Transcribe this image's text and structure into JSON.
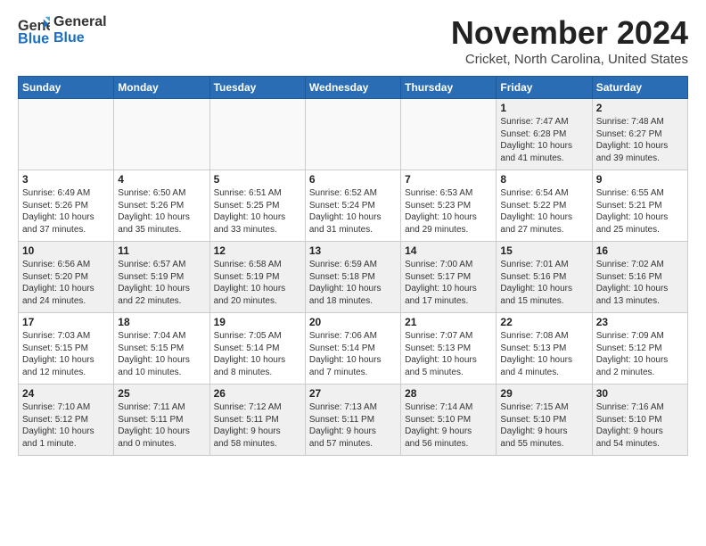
{
  "header": {
    "logo_line1": "General",
    "logo_line2": "Blue",
    "month_title": "November 2024",
    "location": "Cricket, North Carolina, United States"
  },
  "weekdays": [
    "Sunday",
    "Monday",
    "Tuesday",
    "Wednesday",
    "Thursday",
    "Friday",
    "Saturday"
  ],
  "weeks": [
    [
      {
        "day": "",
        "info": ""
      },
      {
        "day": "",
        "info": ""
      },
      {
        "day": "",
        "info": ""
      },
      {
        "day": "",
        "info": ""
      },
      {
        "day": "",
        "info": ""
      },
      {
        "day": "1",
        "info": "Sunrise: 7:47 AM\nSunset: 6:28 PM\nDaylight: 10 hours\nand 41 minutes."
      },
      {
        "day": "2",
        "info": "Sunrise: 7:48 AM\nSunset: 6:27 PM\nDaylight: 10 hours\nand 39 minutes."
      }
    ],
    [
      {
        "day": "3",
        "info": "Sunrise: 6:49 AM\nSunset: 5:26 PM\nDaylight: 10 hours\nand 37 minutes."
      },
      {
        "day": "4",
        "info": "Sunrise: 6:50 AM\nSunset: 5:26 PM\nDaylight: 10 hours\nand 35 minutes."
      },
      {
        "day": "5",
        "info": "Sunrise: 6:51 AM\nSunset: 5:25 PM\nDaylight: 10 hours\nand 33 minutes."
      },
      {
        "day": "6",
        "info": "Sunrise: 6:52 AM\nSunset: 5:24 PM\nDaylight: 10 hours\nand 31 minutes."
      },
      {
        "day": "7",
        "info": "Sunrise: 6:53 AM\nSunset: 5:23 PM\nDaylight: 10 hours\nand 29 minutes."
      },
      {
        "day": "8",
        "info": "Sunrise: 6:54 AM\nSunset: 5:22 PM\nDaylight: 10 hours\nand 27 minutes."
      },
      {
        "day": "9",
        "info": "Sunrise: 6:55 AM\nSunset: 5:21 PM\nDaylight: 10 hours\nand 25 minutes."
      }
    ],
    [
      {
        "day": "10",
        "info": "Sunrise: 6:56 AM\nSunset: 5:20 PM\nDaylight: 10 hours\nand 24 minutes."
      },
      {
        "day": "11",
        "info": "Sunrise: 6:57 AM\nSunset: 5:19 PM\nDaylight: 10 hours\nand 22 minutes."
      },
      {
        "day": "12",
        "info": "Sunrise: 6:58 AM\nSunset: 5:19 PM\nDaylight: 10 hours\nand 20 minutes."
      },
      {
        "day": "13",
        "info": "Sunrise: 6:59 AM\nSunset: 5:18 PM\nDaylight: 10 hours\nand 18 minutes."
      },
      {
        "day": "14",
        "info": "Sunrise: 7:00 AM\nSunset: 5:17 PM\nDaylight: 10 hours\nand 17 minutes."
      },
      {
        "day": "15",
        "info": "Sunrise: 7:01 AM\nSunset: 5:16 PM\nDaylight: 10 hours\nand 15 minutes."
      },
      {
        "day": "16",
        "info": "Sunrise: 7:02 AM\nSunset: 5:16 PM\nDaylight: 10 hours\nand 13 minutes."
      }
    ],
    [
      {
        "day": "17",
        "info": "Sunrise: 7:03 AM\nSunset: 5:15 PM\nDaylight: 10 hours\nand 12 minutes."
      },
      {
        "day": "18",
        "info": "Sunrise: 7:04 AM\nSunset: 5:15 PM\nDaylight: 10 hours\nand 10 minutes."
      },
      {
        "day": "19",
        "info": "Sunrise: 7:05 AM\nSunset: 5:14 PM\nDaylight: 10 hours\nand 8 minutes."
      },
      {
        "day": "20",
        "info": "Sunrise: 7:06 AM\nSunset: 5:14 PM\nDaylight: 10 hours\nand 7 minutes."
      },
      {
        "day": "21",
        "info": "Sunrise: 7:07 AM\nSunset: 5:13 PM\nDaylight: 10 hours\nand 5 minutes."
      },
      {
        "day": "22",
        "info": "Sunrise: 7:08 AM\nSunset: 5:13 PM\nDaylight: 10 hours\nand 4 minutes."
      },
      {
        "day": "23",
        "info": "Sunrise: 7:09 AM\nSunset: 5:12 PM\nDaylight: 10 hours\nand 2 minutes."
      }
    ],
    [
      {
        "day": "24",
        "info": "Sunrise: 7:10 AM\nSunset: 5:12 PM\nDaylight: 10 hours\nand 1 minute."
      },
      {
        "day": "25",
        "info": "Sunrise: 7:11 AM\nSunset: 5:11 PM\nDaylight: 10 hours\nand 0 minutes."
      },
      {
        "day": "26",
        "info": "Sunrise: 7:12 AM\nSunset: 5:11 PM\nDaylight: 9 hours\nand 58 minutes."
      },
      {
        "day": "27",
        "info": "Sunrise: 7:13 AM\nSunset: 5:11 PM\nDaylight: 9 hours\nand 57 minutes."
      },
      {
        "day": "28",
        "info": "Sunrise: 7:14 AM\nSunset: 5:10 PM\nDaylight: 9 hours\nand 56 minutes."
      },
      {
        "day": "29",
        "info": "Sunrise: 7:15 AM\nSunset: 5:10 PM\nDaylight: 9 hours\nand 55 minutes."
      },
      {
        "day": "30",
        "info": "Sunrise: 7:16 AM\nSunset: 5:10 PM\nDaylight: 9 hours\nand 54 minutes."
      }
    ]
  ]
}
